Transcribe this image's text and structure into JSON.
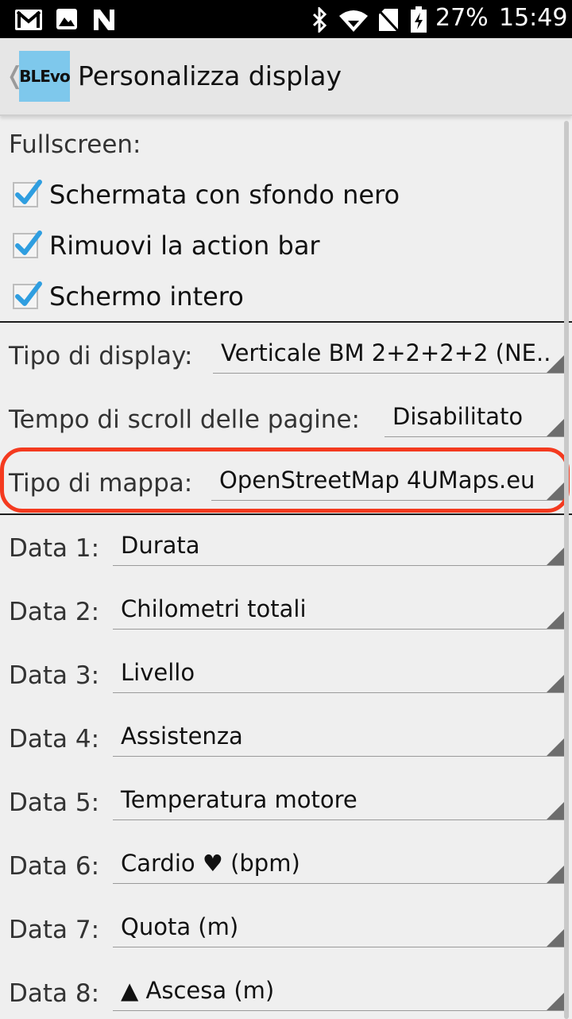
{
  "status_bar": {
    "icons_left": [
      "gmail-icon",
      "image-icon",
      "notification-n-icon"
    ],
    "icons_right": [
      "bluetooth-icon",
      "wifi-icon",
      "no-sim-icon",
      "battery-icon"
    ],
    "battery": "27%",
    "time": "15:49"
  },
  "action_bar": {
    "back_glyph": "❬",
    "logo_text": "BLEvo",
    "logo_color": "#7ec8ec",
    "title": "Personalizza display"
  },
  "fullscreen": {
    "label": "Fullscreen:",
    "options": [
      {
        "label": "Schermata con sfondo nero",
        "checked": true
      },
      {
        "label": "Rimuovi la action bar",
        "checked": true
      },
      {
        "label": "Schermo intero",
        "checked": true
      }
    ]
  },
  "settings": {
    "display_type": {
      "label": "Tipo di display:",
      "value": "Verticale BM 2+2+2+2 (NE.."
    },
    "scroll_time": {
      "label": "Tempo di scroll delle pagine:",
      "value": "Disabilitato"
    },
    "map_type": {
      "label": "Tipo di mappa:",
      "value": "OpenStreetMap 4UMaps.eu"
    }
  },
  "data_fields": [
    {
      "label": "Data 1:",
      "value": "Durata"
    },
    {
      "label": "Data 2:",
      "value": "Chilometri totali"
    },
    {
      "label": "Data 3:",
      "value": "Livello"
    },
    {
      "label": "Data 4:",
      "value": "Assistenza"
    },
    {
      "label": "Data 5:",
      "value": "Temperatura motore"
    },
    {
      "label": "Data 6:",
      "value": "Cardio ♥ (bpm)"
    },
    {
      "label": "Data 7:",
      "value": "Quota (m)"
    },
    {
      "label": "Data 8:",
      "value": "▲ Ascesa (m)"
    }
  ],
  "colors": {
    "highlight": "#f43a1f",
    "checkmark": "#2f9ee0"
  }
}
